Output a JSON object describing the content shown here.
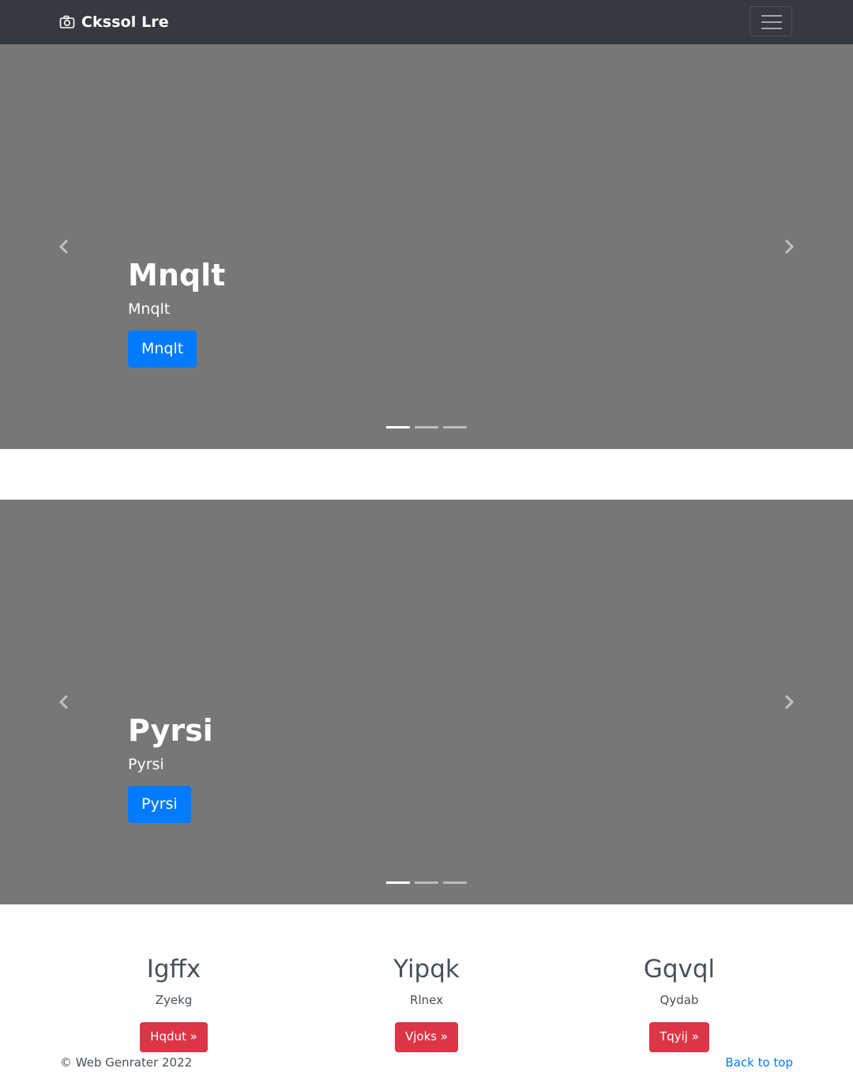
{
  "navbar": {
    "brand": "Ckssol Lre",
    "brand_icon": "camera-icon",
    "toggler_icon": "hamburger-icon"
  },
  "carousels": [
    {
      "heading": "Mnqlt",
      "text": "Mnqlt",
      "button": "Mnqlt",
      "indicator_count": 3,
      "active_indicator": 1
    },
    {
      "heading": "Pyrsi",
      "text": "Pyrsi",
      "button": "Pyrsi",
      "indicator_count": 3,
      "active_indicator": 1
    }
  ],
  "columns": [
    {
      "heading": "Igffx",
      "text": "Zyekg",
      "button": "Hqdut »"
    },
    {
      "heading": "Yipqk",
      "text": "Rlnex",
      "button": "Vjoks »"
    },
    {
      "heading": "Gqvql",
      "text": "Qydab",
      "button": "Tqyij »"
    }
  ],
  "footer": {
    "copyright": "© Web Genrater 2022",
    "back_to_top": "Back to top"
  },
  "colors": {
    "navbar_bg": "#343a40",
    "carousel_bg": "#777777",
    "primary": "#007bff",
    "danger": "#dc3545"
  }
}
